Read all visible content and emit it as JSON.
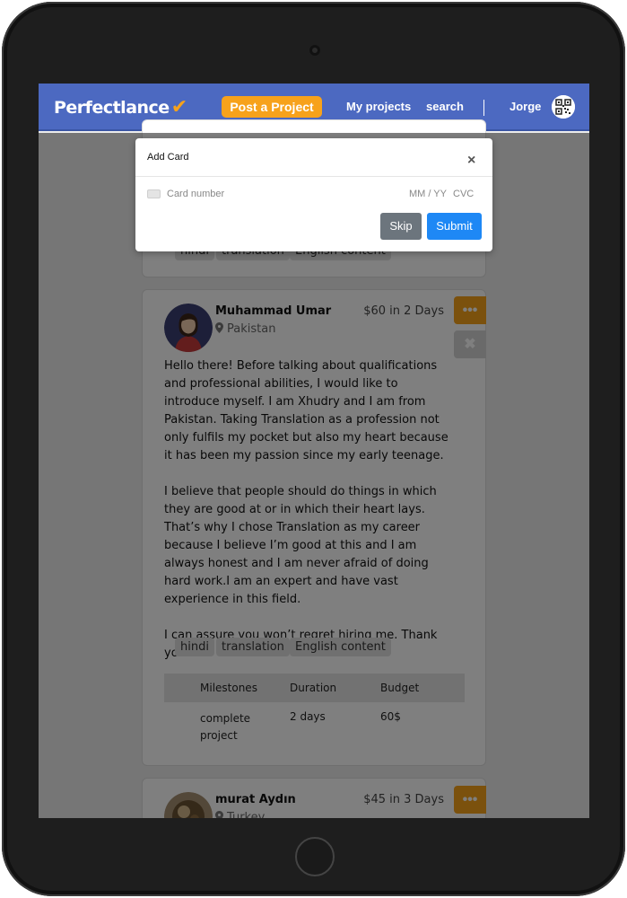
{
  "navbar": {
    "logo": "Perfectlance",
    "logo_check": "✔",
    "post_button": "Post a Project",
    "my_projects": "My projects",
    "search": "search",
    "user_name": "Jorge"
  },
  "previous_card": {
    "tags": [
      "hindi",
      "translation",
      "English content"
    ]
  },
  "proposals": [
    {
      "name": "Muhammad Umar",
      "location": "Pakistan",
      "price": "$60 in 2 Days",
      "bio": [
        "Hello there! Before talking about qualifications and professional abilities, I would like to introduce myself. I am Xhudry and I am from Pakistan. Taking Translation as a profession not only fulfils my pocket but also my heart because it has been my passion since my early teenage.",
        "I believe that people should do things in which they are good at or in which their heart lays. That’s why I chose Translation as my career because I believe I’m good at this and I am always honest and I am never afraid of doing hard work.I am an expert and have vast experience in this field.",
        "I can assure you won’t regret hiring me. Thank you"
      ],
      "tags": [
        "hindi",
        "translation",
        "English content"
      ],
      "milestones": {
        "headers": [
          "Milestones",
          "Duration",
          "Budget"
        ],
        "rows": [
          {
            "milestone": "complete project",
            "duration": "2 days",
            "budget": "60$"
          }
        ]
      },
      "more_button": "•••",
      "reject_button": "✖"
    },
    {
      "name": "murat Aydın",
      "location": "Turkey",
      "price": "$45 in 3 Days",
      "more_button": "•••"
    }
  ],
  "modal": {
    "title": "Add Card",
    "close": "×",
    "card_number_placeholder": "Card number",
    "mm_yy": "MM / YY",
    "cvc": "CVC",
    "skip": "Skip",
    "submit": "Submit"
  },
  "colors": {
    "navbar": "#4c69c1",
    "accent_orange": "#f7a21b",
    "submit_blue": "#1e88f5",
    "skip_gray": "#6c757d"
  }
}
